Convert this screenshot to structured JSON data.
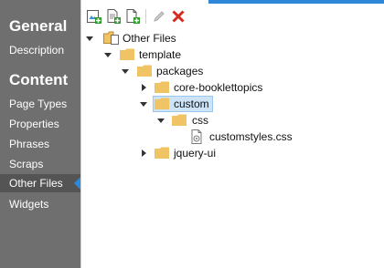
{
  "sidebar": {
    "general_heading": "General",
    "general_items": [
      {
        "label": "Description"
      }
    ],
    "content_heading": "Content",
    "content_items": [
      {
        "label": "Page Types"
      },
      {
        "label": "Properties"
      },
      {
        "label": "Phrases"
      },
      {
        "label": "Scraps"
      },
      {
        "label": "Other Files"
      },
      {
        "label": "Widgets"
      }
    ],
    "active_item": "Other Files"
  },
  "toolbar": {
    "buttons": [
      "add-folder-icon",
      "add-file-icon",
      "upload-file-icon",
      "edit-icon",
      "delete-icon"
    ]
  },
  "tree": {
    "nodes": [
      {
        "label": "Other Files",
        "type": "root-folder",
        "expanded": true
      },
      {
        "label": "template",
        "type": "folder",
        "expanded": true
      },
      {
        "label": "packages",
        "type": "folder",
        "expanded": true
      },
      {
        "label": "core-booklettopics",
        "type": "folder",
        "expanded": false
      },
      {
        "label": "custom",
        "type": "folder",
        "expanded": true,
        "selected": true
      },
      {
        "label": "css",
        "type": "folder",
        "expanded": true
      },
      {
        "label": "customstyles.css",
        "type": "file"
      },
      {
        "label": "jquery-ui",
        "type": "folder",
        "expanded": false
      }
    ]
  },
  "colors": {
    "sidebar_bg": "#6f6f6f",
    "sidebar_active_bg": "#545454",
    "accent": "#2f87d8",
    "folder": "#f0c465",
    "delete": "#d42b1e",
    "selection": "#cde4f7"
  }
}
